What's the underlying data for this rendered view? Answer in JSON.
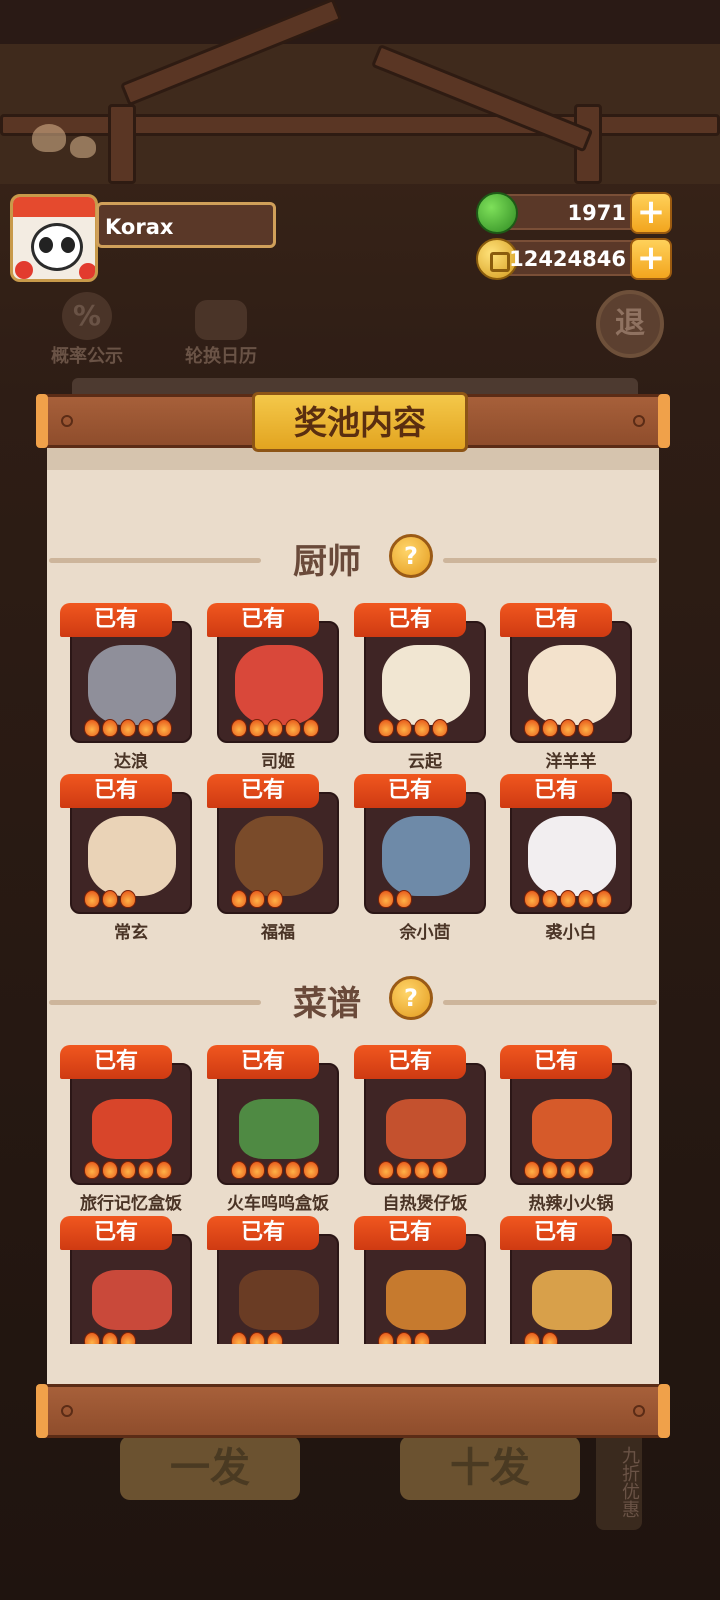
{
  "header": {
    "player_name": "Korax",
    "jade_amount": "1971",
    "coin_amount": "12424846",
    "add_label": "+"
  },
  "background": {
    "probability_label": "概率公示",
    "rotation_label": "轮换日历",
    "back_label": "退",
    "pull_one_label": "一发",
    "pull_ten_label": "十发",
    "discount_label": "九折优惠"
  },
  "panel": {
    "title": "奖池内容",
    "help_label": "?",
    "chef_section_title": "厨师",
    "recipe_section_title": "菜谱",
    "owned_label": "已有"
  },
  "chefs": [
    {
      "name": "达浪",
      "stars": 5
    },
    {
      "name": "司姬",
      "stars": 5
    },
    {
      "name": "云起",
      "stars": 4
    },
    {
      "name": "洋羊羊",
      "stars": 4
    },
    {
      "name": "常玄",
      "stars": 3
    },
    {
      "name": "福福",
      "stars": 3
    },
    {
      "name": "佘小茴",
      "stars": 2
    },
    {
      "name": "裘小白",
      "stars": 5
    }
  ],
  "recipes": [
    {
      "name": "旅行记忆盒饭",
      "stars": 5
    },
    {
      "name": "火车呜呜盒饭",
      "stars": 5
    },
    {
      "name": "自热煲仔饭",
      "stars": 4
    },
    {
      "name": "热辣小火锅",
      "stars": 4
    },
    {
      "name": "",
      "stars": 3
    },
    {
      "name": "",
      "stars": 3
    },
    {
      "name": "",
      "stars": 3
    },
    {
      "name": "",
      "stars": 2
    }
  ],
  "colors": {
    "panel_bg": "#eadccb",
    "badge": "#e24a1a",
    "card_bg": "#3f2525",
    "title_tag": "#f0bc3a",
    "plank": "#9b5532"
  }
}
